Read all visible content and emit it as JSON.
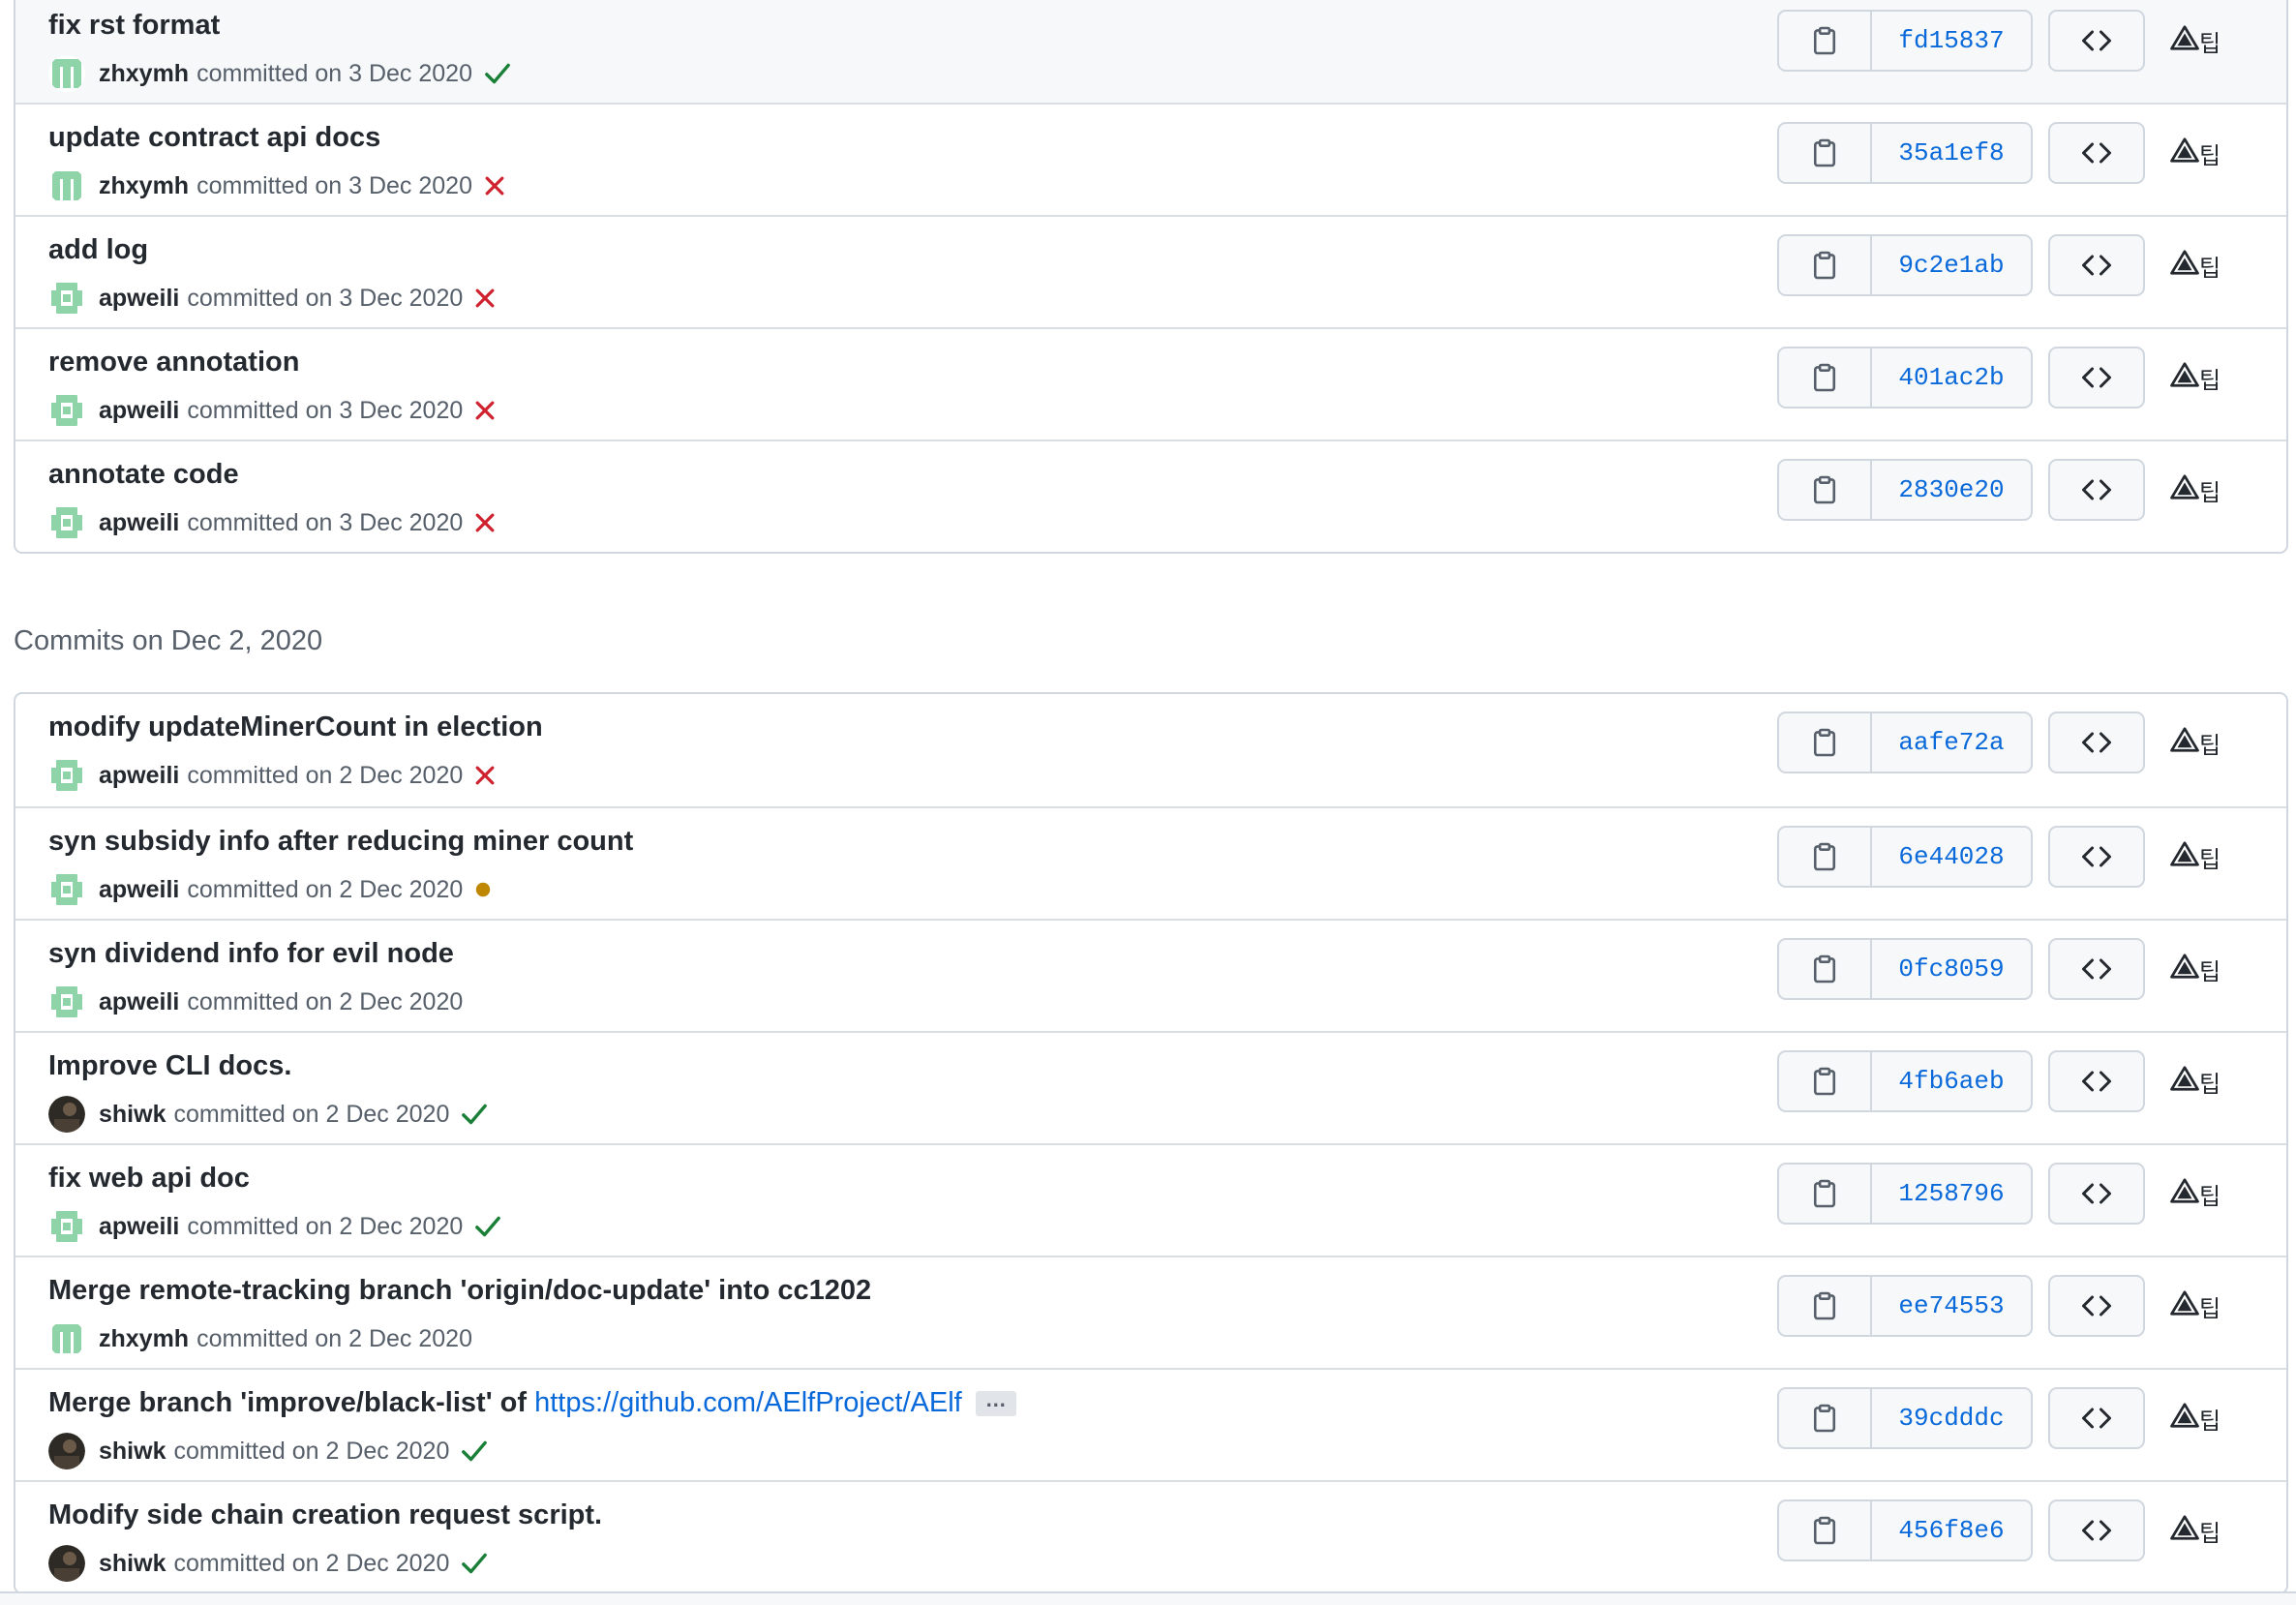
{
  "group1": {
    "commits": [
      {
        "message": "fix rst format",
        "author": "zhxymh",
        "date": "committed on 3 Dec 2020",
        "status": "success",
        "sha": "fd15837",
        "avatar": "zhxymh"
      },
      {
        "message": "update contract api docs",
        "author": "zhxymh",
        "date": "committed on 3 Dec 2020",
        "status": "failure",
        "sha": "35a1ef8",
        "avatar": "zhxymh"
      },
      {
        "message": "add log",
        "author": "apweili",
        "date": "committed on 3 Dec 2020",
        "status": "failure",
        "sha": "9c2e1ab",
        "avatar": "apweili"
      },
      {
        "message": "remove annotation",
        "author": "apweili",
        "date": "committed on 3 Dec 2020",
        "status": "failure",
        "sha": "401ac2b",
        "avatar": "apweili"
      },
      {
        "message": "annotate code",
        "author": "apweili",
        "date": "committed on 3 Dec 2020",
        "status": "failure",
        "sha": "2830e20",
        "avatar": "apweili"
      }
    ]
  },
  "group2": {
    "heading": "Commits on Dec 2, 2020",
    "commits": [
      {
        "message": "modify updateMinerCount in election",
        "author": "apweili",
        "date": "committed on 2 Dec 2020",
        "status": "failure",
        "sha": "aafe72a",
        "avatar": "apweili"
      },
      {
        "message": "syn subsidy info after reducing miner count",
        "author": "apweili",
        "date": "committed on 2 Dec 2020",
        "status": "pending",
        "sha": "6e44028",
        "avatar": "apweili"
      },
      {
        "message": "syn dividend info for evil node",
        "author": "apweili",
        "date": "committed on 2 Dec 2020",
        "status": "none",
        "sha": "0fc8059",
        "avatar": "apweili"
      },
      {
        "message": "Improve CLI docs.",
        "author": "shiwk",
        "date": "committed on 2 Dec 2020",
        "status": "success",
        "sha": "4fb6aeb",
        "avatar": "shiwk"
      },
      {
        "message": "fix web api doc",
        "author": "apweili",
        "date": "committed on 2 Dec 2020",
        "status": "success",
        "sha": "1258796",
        "avatar": "apweili"
      },
      {
        "message": "Merge remote-tracking branch 'origin/doc-update' into cc1202",
        "author": "zhxymh",
        "date": "committed on 2 Dec 2020",
        "status": "none",
        "sha": "ee74553",
        "avatar": "zhxymh"
      },
      {
        "message": "Merge branch 'improve/black-list' of ",
        "link": "https://github.com/AElfProject/AElf",
        "ellipsis": "…",
        "author": "shiwk",
        "date": "committed on 2 Dec 2020",
        "status": "success",
        "sha": "39cdddc",
        "avatar": "shiwk"
      },
      {
        "message": "Modify side chain creation request script.",
        "author": "shiwk",
        "date": "committed on 2 Dec 2020",
        "status": "success",
        "sha": "456f8e6",
        "avatar": "shiwk"
      }
    ]
  },
  "extra_label": "팁",
  "icons": {
    "copy": "clipboard-icon",
    "browse": "code-icon",
    "extra": "warning-icon",
    "success": "check-icon",
    "failure": "x-icon",
    "pending": "dot-icon"
  },
  "colors": {
    "success": "#1a7f37",
    "failure": "#cf222e",
    "pending": "#bf8700",
    "link": "#0969da",
    "avatar_green": "#8fd3a8"
  }
}
